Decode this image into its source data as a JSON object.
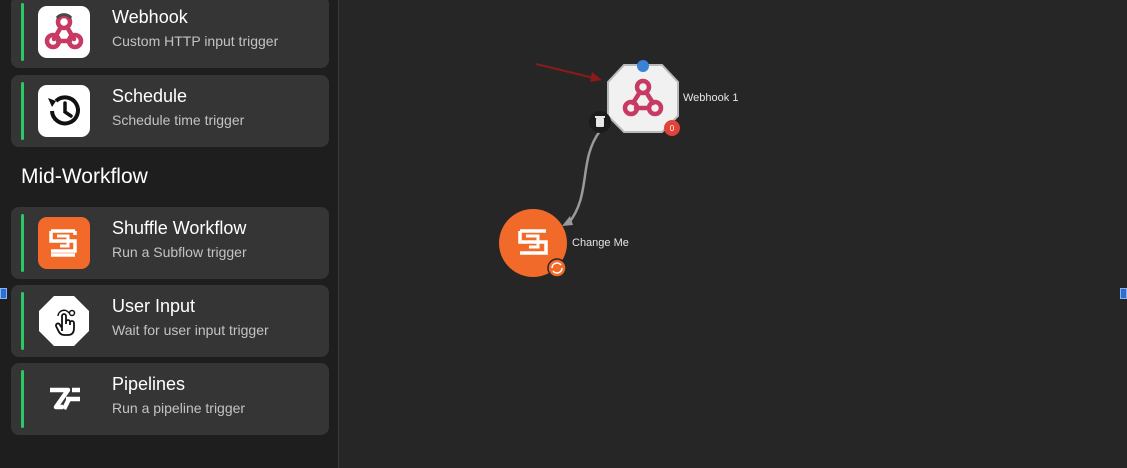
{
  "sidebar": {
    "triggers": [
      {
        "title": "Webhook",
        "subtitle": "Custom HTTP input trigger",
        "icon": "webhook-icon"
      },
      {
        "title": "Schedule",
        "subtitle": "Schedule time trigger",
        "icon": "clock-icon"
      }
    ],
    "mid_workflow_heading": "Mid-Workflow",
    "mid_workflow": [
      {
        "title": "Shuffle Workflow",
        "subtitle": "Run a Subflow trigger",
        "icon": "shuffle-icon"
      },
      {
        "title": "User Input",
        "subtitle": "Wait for user input trigger",
        "icon": "hand-pointer-icon"
      },
      {
        "title": "Pipelines",
        "subtitle": "Run a pipeline trigger",
        "icon": "pipelines-icon"
      }
    ]
  },
  "canvas": {
    "nodes": [
      {
        "label": "Webhook 1",
        "badge": "0",
        "icon": "webhook-icon"
      },
      {
        "label": "Change Me",
        "icon": "shuffle-icon"
      }
    ]
  },
  "colors": {
    "accent_green": "#2ec765",
    "shuffle_orange": "#f26a2a",
    "webhook_pink": "#c73a63",
    "badge_red": "#e0433a",
    "arrow_red": "#8b1a1a"
  }
}
